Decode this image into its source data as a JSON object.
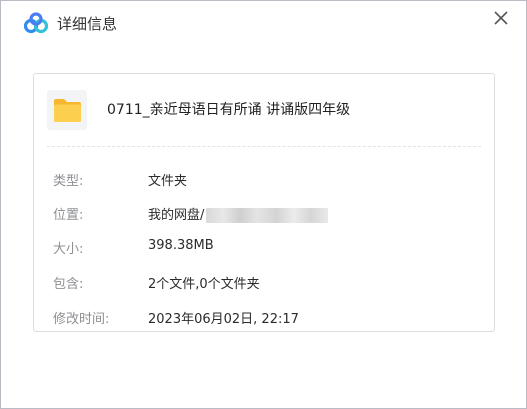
{
  "window": {
    "title": "详细信息",
    "close_symbol": "✕"
  },
  "file": {
    "name": "0711_亲近母语日有所诵 讲诵版四年级",
    "icon": "folder-icon"
  },
  "details": [
    {
      "label": "类型:",
      "value": "文件夹"
    },
    {
      "label": "位置:",
      "value": "我的网盘/"
    },
    {
      "label": "大小:",
      "value": "398.38MB"
    },
    {
      "label": "包含:",
      "value": "2个文件,0个文件夹"
    },
    {
      "label": "修改时间:",
      "value": "2023年06月02日, 22:17"
    }
  ],
  "colors": {
    "accent_blue": "#2f8cf0",
    "folder_yellow": "#f9c33f"
  }
}
